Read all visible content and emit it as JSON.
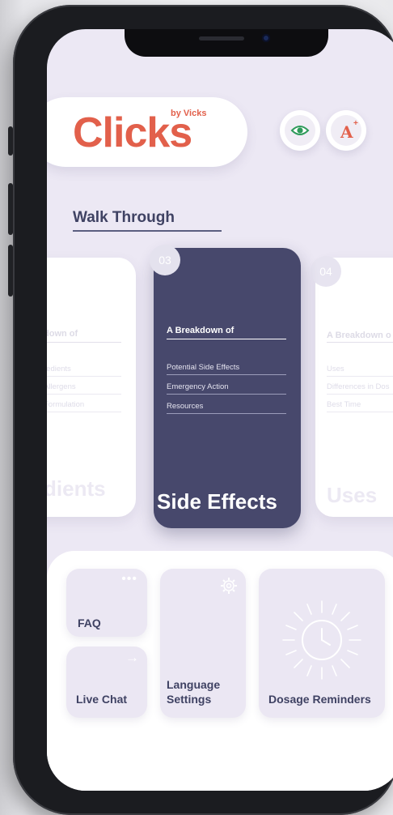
{
  "app": {
    "logo_text": "Clicks",
    "logo_subtext": "by Vicks",
    "brand_color": "#e2604b",
    "accent_color": "#47486c"
  },
  "header": {
    "eye_icon": "eye-icon",
    "font_size_icon": "text-size-icon",
    "font_size_label": "A",
    "font_size_plus": "+"
  },
  "walkthrough": {
    "title": "Walk Through",
    "cards": [
      {
        "number": "",
        "subtitle": "down of",
        "items": [
          "redients",
          "Allergens",
          "Formulation"
        ],
        "big_label": "dients"
      },
      {
        "number": "03",
        "subtitle": "A Breakdown of",
        "items": [
          "Potential Side Effects",
          "Emergency Action",
          "Resources"
        ],
        "big_label": "Side Effects"
      },
      {
        "number": "04",
        "subtitle": "A Breakdown o",
        "items": [
          "Uses",
          "Differences in Dos",
          "Best Time"
        ],
        "big_label": "Uses"
      }
    ]
  },
  "tiles": {
    "faq": {
      "label": "FAQ",
      "icon": "more-dots-icon"
    },
    "live_chat": {
      "label": "Live Chat",
      "icon": "arrow-right-icon"
    },
    "language": {
      "label_line1": "Language",
      "label_line2": "Settings",
      "icon": "gear-icon"
    },
    "dosage": {
      "label": "Dosage Reminders",
      "icon": "clock-icon"
    }
  }
}
